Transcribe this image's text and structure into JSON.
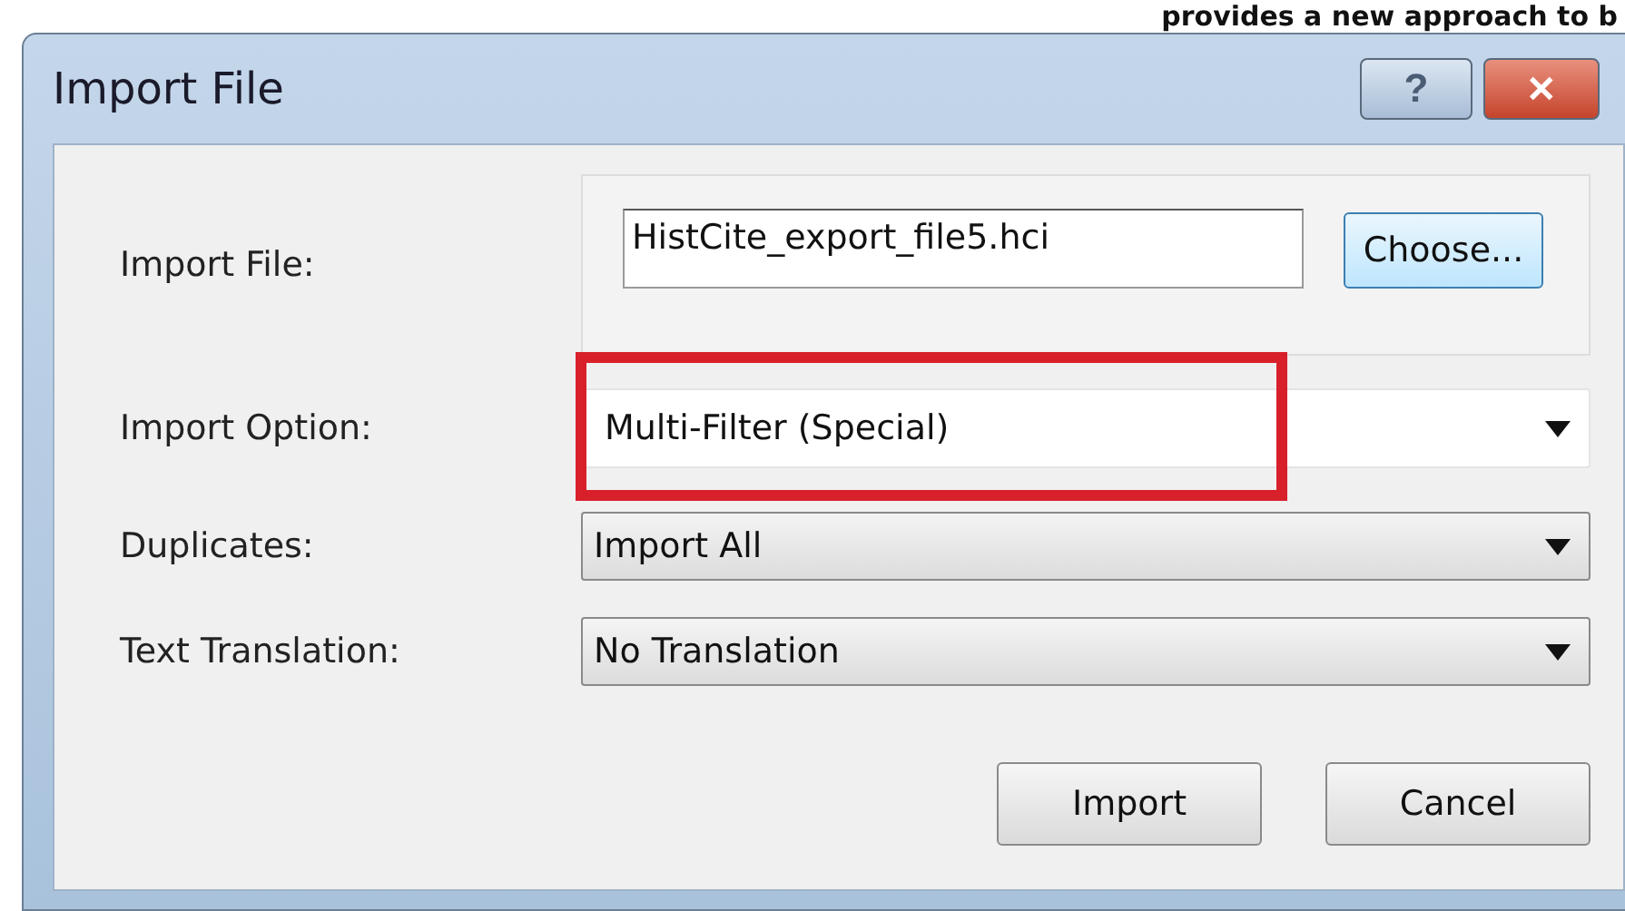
{
  "background_text": "provides a new approach to b",
  "window": {
    "title": "Import File",
    "buttons": [
      {
        "kind": "help",
        "label": "?"
      },
      {
        "kind": "close",
        "label": "✕"
      }
    ]
  },
  "file_row": {
    "label": "Import File:",
    "value": "HistCite_export_file5.hci",
    "button": "Choose..."
  },
  "options": [
    {
      "label": "Import Option:",
      "value": "Multi-Filter (Special)",
      "highlighted": true,
      "kind": "flat"
    },
    {
      "label": "Duplicates:",
      "value": "Import All",
      "highlighted": false,
      "kind": "combo"
    },
    {
      "label": "Text Translation:",
      "value": "No Translation",
      "highlighted": false,
      "kind": "combo"
    }
  ],
  "buttons": [
    "Import",
    "Cancel"
  ]
}
